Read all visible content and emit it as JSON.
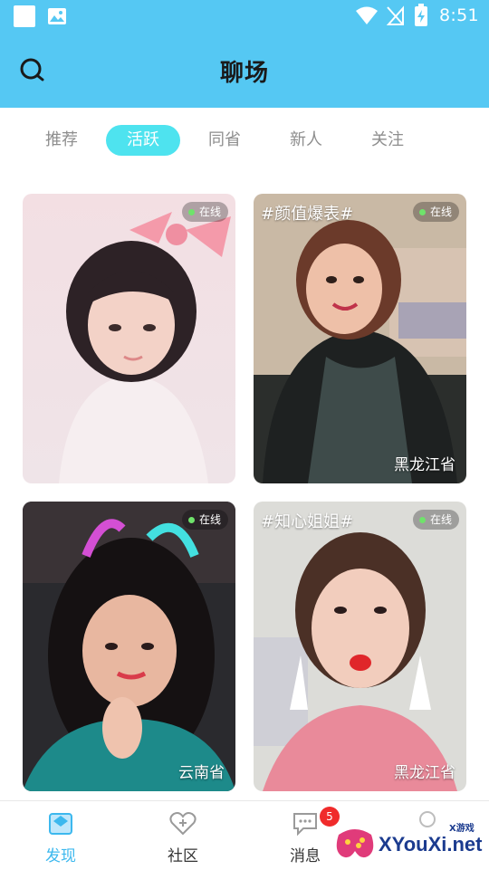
{
  "status_bar": {
    "time": "8:51",
    "icons": [
      "white-square-icon",
      "image-icon",
      "wifi-icon",
      "no-sim-icon",
      "battery-charging-icon"
    ]
  },
  "header": {
    "title": "聊场",
    "search_icon": "search-icon",
    "background_color": "#55c8f3"
  },
  "tabs": [
    {
      "label": "推荐",
      "active": false
    },
    {
      "label": "活跃",
      "active": true
    },
    {
      "label": "同省",
      "active": false
    },
    {
      "label": "新人",
      "active": false
    },
    {
      "label": "关注",
      "active": false
    }
  ],
  "accent_color": "#4ee3ef",
  "cards": [
    {
      "online_label": "在线",
      "tag": "",
      "location": ""
    },
    {
      "online_label": "在线",
      "tag": "#颜值爆表#",
      "location": "黑龙江省"
    },
    {
      "online_label": "在线",
      "tag": "",
      "location": "云南省"
    },
    {
      "online_label": "在线",
      "tag": "#知心姐姐#",
      "location": "黑龙江省"
    }
  ],
  "bottom_nav": [
    {
      "label": "发现",
      "icon": "discover-icon",
      "active": true
    },
    {
      "label": "社区",
      "icon": "heart-plus-icon",
      "active": false
    },
    {
      "label": "消息",
      "icon": "chat-bubble-icon",
      "active": false,
      "badge": "5"
    },
    {
      "label": "",
      "icon": "profile-icon",
      "active": false
    }
  ],
  "watermark": {
    "text": "XYouXi.net",
    "small": "X游戏"
  }
}
